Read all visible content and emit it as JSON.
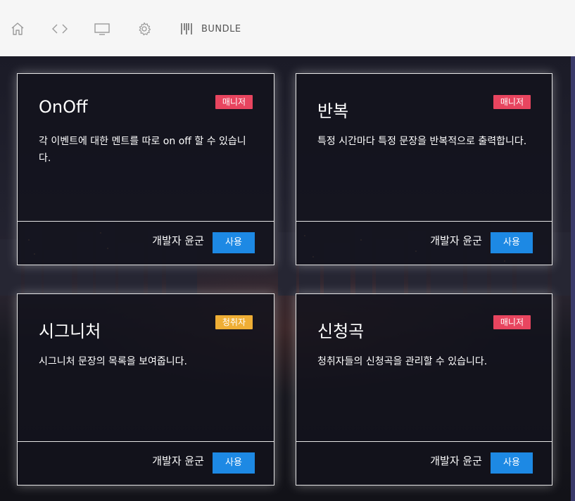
{
  "toolbar": {
    "home_icon": "home-icon",
    "code_icon": "code-icon",
    "monitor_icon": "monitor-icon",
    "settings_icon": "gear-icon",
    "bundle_icon": "barcode-icon",
    "bundle_label": "BUNDLE"
  },
  "colors": {
    "manager_badge": "#e8455f",
    "listener_badge": "#efae35",
    "use_button": "#1d89e4"
  },
  "cards": [
    {
      "title": "OnOff",
      "badge": "매니저",
      "badge_type": "manager",
      "description": "각 이벤트에 대한 멘트를 따로 on off 할 수 있습니다.",
      "author": "개발자 윤군",
      "button": "사용"
    },
    {
      "title": "반복",
      "badge": "매니저",
      "badge_type": "manager",
      "description": "특정 시간마다 특정 문장을 반복적으로 출력합니다.",
      "author": "개발자 윤군",
      "button": "사용"
    },
    {
      "title": "시그니처",
      "badge": "청취자",
      "badge_type": "listener",
      "description": "시그니처 문장의 목록을 보여줍니다.",
      "author": "개발자 윤군",
      "button": "사용"
    },
    {
      "title": "신청곡",
      "badge": "매니저",
      "badge_type": "manager",
      "description": "청취자들의 신청곡을 관리할 수 있습니다.",
      "author": "개발자 윤군",
      "button": "사용"
    }
  ]
}
